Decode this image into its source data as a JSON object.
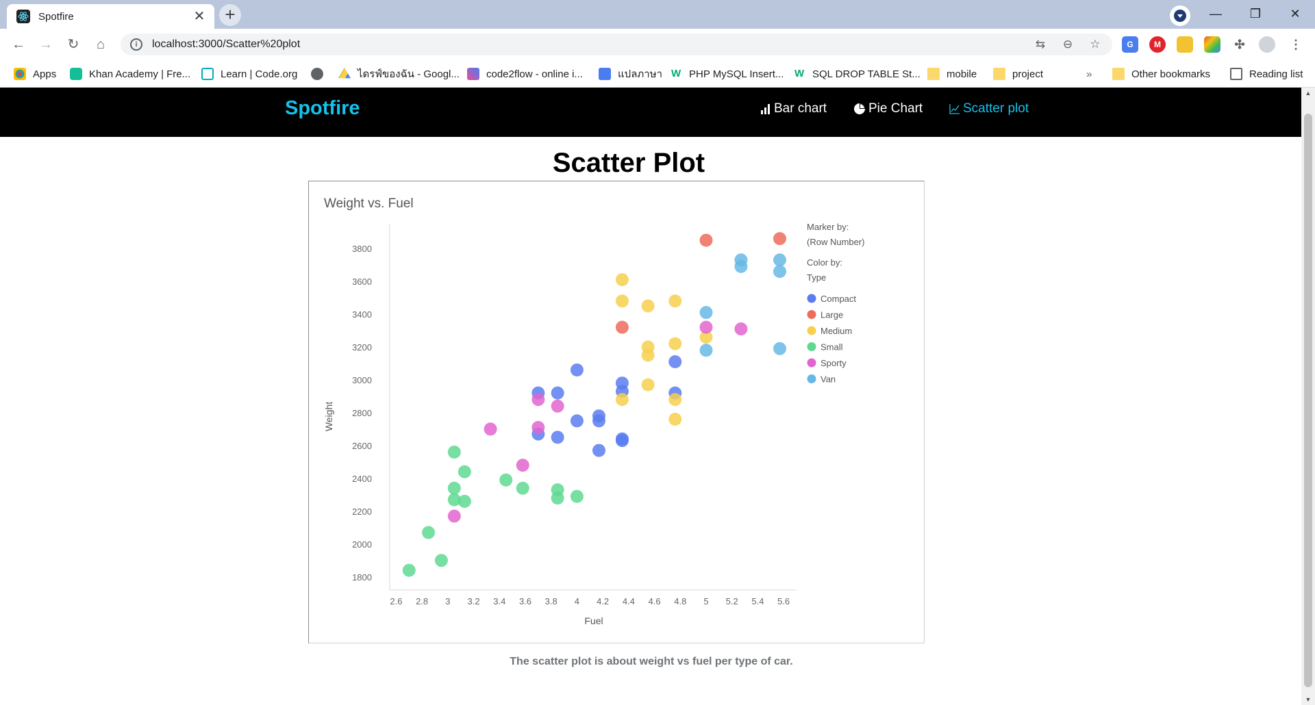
{
  "browser": {
    "tab_title": "Spotfire",
    "url": "localhost:3000/Scatter%20plot",
    "bookmarks": [
      "Apps",
      "Khan Academy | Fre...",
      "Learn | Code.org",
      "ไดรฟ์ของฉัน - Googl...",
      "code2flow - online i...",
      "แปลภาษา",
      "PHP MySQL Insert...",
      "SQL DROP TABLE St...",
      "mobile",
      "project"
    ],
    "overflow_label": "»",
    "other_bookmarks": "Other bookmarks",
    "reading_list": "Reading list"
  },
  "nav": {
    "brand": "Spotfire",
    "links": [
      "Bar chart",
      "Pie Chart",
      "Scatter plot"
    ],
    "active_link": "Scatter plot"
  },
  "page": {
    "title": "Scatter Plot",
    "caption": "The scatter plot is about weight vs fuel per type of car."
  },
  "chart_data": {
    "type": "scatter",
    "title": "Weight vs. Fuel",
    "xlabel": "Fuel",
    "ylabel": "Weight",
    "xlim": [
      2.55,
      5.7
    ],
    "ylim": [
      1720,
      3950
    ],
    "xticks": [
      2.6,
      2.8,
      3,
      3.2,
      3.4,
      3.6,
      3.8,
      4,
      4.2,
      4.4,
      4.6,
      4.8,
      5,
      5.2,
      5.4,
      5.6
    ],
    "xtick_labels": [
      "2.6",
      "2.8",
      "3",
      "3.2",
      "3.4",
      "3.6",
      "3.8",
      "4",
      "4.2",
      "4.4",
      "4.6",
      "4.8",
      "5",
      "5.2",
      "5.4",
      "5.6"
    ],
    "yticks": [
      1800,
      2000,
      2200,
      2400,
      2600,
      2800,
      3000,
      3200,
      3400,
      3600,
      3800
    ],
    "ytick_labels": [
      "1800",
      "2000",
      "2200",
      "2400",
      "2600",
      "2800",
      "3000",
      "3200",
      "3400",
      "3600",
      "3800"
    ],
    "grid": false,
    "legend_position": "right",
    "legend": {
      "marker_by_label": "Marker by:",
      "marker_by_value": "(Row Number)",
      "color_by_label": "Color by:",
      "color_by_value": "Type"
    },
    "series": [
      {
        "name": "Compact",
        "color": "#5b7cf0",
        "points": [
          [
            3.7,
            2920
          ],
          [
            3.7,
            2670
          ],
          [
            3.85,
            2920
          ],
          [
            3.85,
            2650
          ],
          [
            4,
            3060
          ],
          [
            4,
            2750
          ],
          [
            4.17,
            2780
          ],
          [
            4.17,
            2750
          ],
          [
            4.17,
            2570
          ],
          [
            4.35,
            2980
          ],
          [
            4.35,
            2930
          ],
          [
            4.35,
            2640
          ],
          [
            4.35,
            2630
          ],
          [
            4.76,
            3110
          ],
          [
            4.76,
            2920
          ]
        ]
      },
      {
        "name": "Large",
        "color": "#ef6b5c",
        "points": [
          [
            4.35,
            3320
          ],
          [
            5,
            3850
          ],
          [
            5.57,
            3860
          ]
        ]
      },
      {
        "name": "Medium",
        "color": "#f7d04f",
        "points": [
          [
            4.35,
            3610
          ],
          [
            4.35,
            3480
          ],
          [
            4.35,
            2880
          ],
          [
            4.55,
            3450
          ],
          [
            4.55,
            3200
          ],
          [
            4.55,
            3150
          ],
          [
            4.55,
            2970
          ],
          [
            4.76,
            3480
          ],
          [
            4.76,
            3220
          ],
          [
            4.76,
            2880
          ],
          [
            4.76,
            2760
          ],
          [
            5,
            3260
          ]
        ]
      },
      {
        "name": "Small",
        "color": "#5ed991",
        "points": [
          [
            2.7,
            1840
          ],
          [
            2.85,
            2070
          ],
          [
            2.95,
            1900
          ],
          [
            3.05,
            2560
          ],
          [
            3.05,
            2340
          ],
          [
            3.05,
            2270
          ],
          [
            3.13,
            2440
          ],
          [
            3.13,
            2260
          ],
          [
            3.45,
            2390
          ],
          [
            3.58,
            2340
          ],
          [
            3.85,
            2330
          ],
          [
            3.85,
            2280
          ],
          [
            4,
            2290
          ]
        ]
      },
      {
        "name": "Sporty",
        "color": "#e265cf",
        "points": [
          [
            3.05,
            2170
          ],
          [
            3.33,
            2700
          ],
          [
            3.58,
            2480
          ],
          [
            3.7,
            2880
          ],
          [
            3.7,
            2710
          ],
          [
            3.85,
            2840
          ],
          [
            5,
            3320
          ],
          [
            5.27,
            3310
          ]
        ]
      },
      {
        "name": "Van",
        "color": "#66b8e6",
        "points": [
          [
            5,
            3410
          ],
          [
            5,
            3180
          ],
          [
            5.27,
            3730
          ],
          [
            5.27,
            3690
          ],
          [
            5.57,
            3730
          ],
          [
            5.57,
            3660
          ],
          [
            5.57,
            3190
          ]
        ]
      }
    ]
  }
}
